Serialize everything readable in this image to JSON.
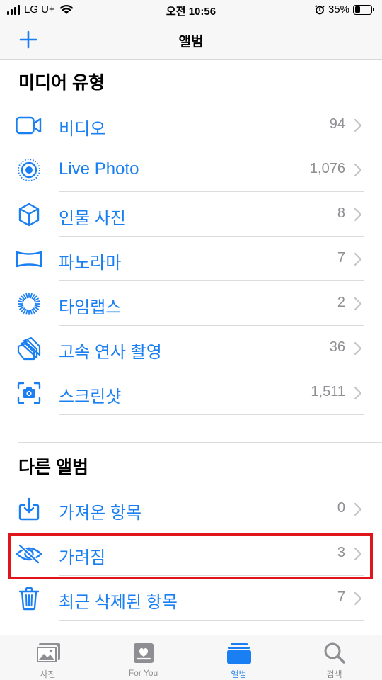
{
  "status_bar": {
    "carrier": "LG U+",
    "time": "오전 10:56",
    "battery_percent": "35%",
    "battery_level": 0.35
  },
  "nav": {
    "title": "앨범",
    "add_icon": "plus-icon"
  },
  "media_types": {
    "title": "미디어 유형",
    "items": [
      {
        "icon": "video-icon",
        "label": "비디오",
        "count": "94"
      },
      {
        "icon": "live-photo-icon",
        "label": "Live Photo",
        "count": "1,076"
      },
      {
        "icon": "cube-icon",
        "label": "인물 사진",
        "count": "8"
      },
      {
        "icon": "panorama-icon",
        "label": "파노라마",
        "count": "7"
      },
      {
        "icon": "timelapse-icon",
        "label": "타임랩스",
        "count": "2"
      },
      {
        "icon": "burst-icon",
        "label": "고속 연사 촬영",
        "count": "36"
      },
      {
        "icon": "screenshot-icon",
        "label": "스크린샷",
        "count": "1,511"
      }
    ]
  },
  "other_albums": {
    "title": "다른 앨범",
    "items": [
      {
        "icon": "import-icon",
        "label": "가져온 항목",
        "count": "0"
      },
      {
        "icon": "hidden-eye-icon",
        "label": "가려짐",
        "count": "3"
      },
      {
        "icon": "trash-icon",
        "label": "최근 삭제된 항목",
        "count": "7"
      }
    ]
  },
  "tabs": [
    {
      "icon": "photos-icon",
      "label": "사진",
      "active": false
    },
    {
      "icon": "for-you-icon",
      "label": "For You",
      "active": false
    },
    {
      "icon": "albums-icon",
      "label": "앨범",
      "active": true
    },
    {
      "icon": "search-icon",
      "label": "검색",
      "active": false
    }
  ],
  "colors": {
    "accent": "#1a7ff2",
    "highlight_border": "#e0151c",
    "secondary_text": "#8e8e93"
  }
}
